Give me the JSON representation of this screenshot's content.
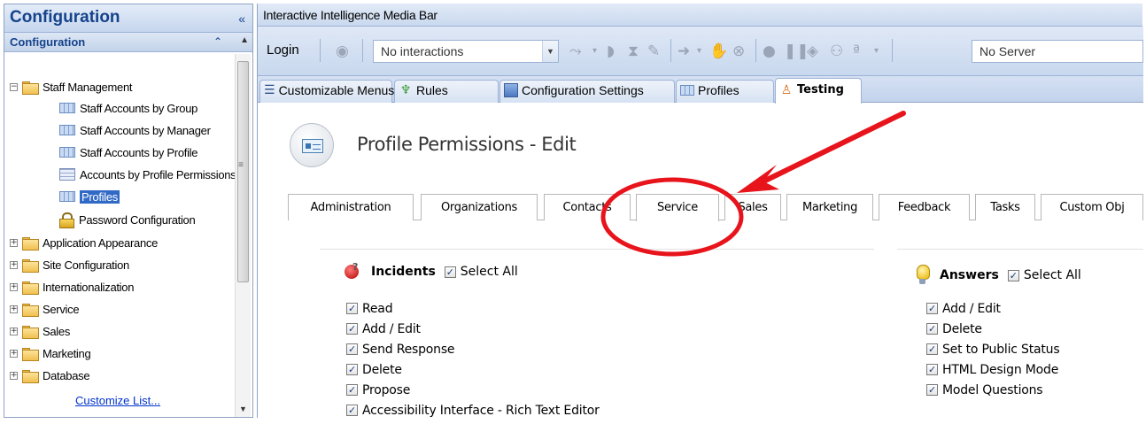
{
  "nav": {
    "title": "Configuration",
    "collapse_glyph": "«",
    "section_title": "Configuration",
    "section_glyph": "⌃",
    "tree": [
      {
        "label": "Staff Management",
        "level": 0,
        "expander": "⊟",
        "icon": "folder-icon"
      },
      {
        "label": "Staff Accounts by Group",
        "level": 1,
        "icon": "report-icon"
      },
      {
        "label": "Staff Accounts by Manager",
        "level": 1,
        "icon": "report-icon"
      },
      {
        "label": "Staff Accounts by Profile",
        "level": 1,
        "icon": "report-icon"
      },
      {
        "label": "Accounts by Profile Permissions",
        "level": 1,
        "icon": "grid-icon"
      },
      {
        "label": "Profiles",
        "level": 1,
        "icon": "report-icon",
        "selected": true
      },
      {
        "label": "Password Configuration",
        "level": 1,
        "icon": "lock-icon"
      },
      {
        "label": "Application Appearance",
        "level": 0,
        "expander": "⊞",
        "icon": "folder-icon"
      },
      {
        "label": "Site Configuration",
        "level": 0,
        "expander": "⊞",
        "icon": "folder-icon"
      },
      {
        "label": "Internationalization",
        "level": 0,
        "expander": "⊞",
        "icon": "folder-icon"
      },
      {
        "label": "Service",
        "level": 0,
        "expander": "⊞",
        "icon": "folder-icon"
      },
      {
        "label": "Sales",
        "level": 0,
        "expander": "⊞",
        "icon": "folder-icon"
      },
      {
        "label": "Marketing",
        "level": 0,
        "expander": "⊞",
        "icon": "folder-icon"
      },
      {
        "label": "Database",
        "level": 0,
        "expander": "⊞",
        "icon": "folder-icon"
      }
    ],
    "customize_link": "Customize List..."
  },
  "media_bar": {
    "title": "Interactive Intelligence Media Bar",
    "login_label": "Login",
    "interactions_value": "No interactions",
    "server_value": "No Server"
  },
  "doc_tabs": [
    {
      "label": "Customizable Menus",
      "icon": "menu-icon"
    },
    {
      "label": "Rules",
      "icon": "rules-icon"
    },
    {
      "label": "Configuration Settings",
      "icon": "config-icon"
    },
    {
      "label": "Profiles",
      "icon": "profiles-icon"
    },
    {
      "label": "Testing",
      "icon": "testing-icon",
      "active": true
    }
  ],
  "page": {
    "title": "Profile Permissions - Edit"
  },
  "permission_tabs": [
    {
      "label": "Administration"
    },
    {
      "label": "Organizations"
    },
    {
      "label": "Contacts"
    },
    {
      "label": "Service",
      "active": true
    },
    {
      "label": "Sales"
    },
    {
      "label": "Marketing"
    },
    {
      "label": "Feedback"
    },
    {
      "label": "Tasks"
    },
    {
      "label": "Custom Obj"
    }
  ],
  "incidents": {
    "label": "Incidents",
    "select_all": "Select All",
    "permissions": [
      "Read",
      "Add / Edit",
      "Send Response",
      "Delete",
      "Propose",
      "Accessibility Interface - Rich Text Editor"
    ]
  },
  "answers": {
    "label": "Answers",
    "select_all": "Select All",
    "permissions": [
      "Add / Edit",
      "Delete",
      "Set to Public Status",
      "HTML Design Mode",
      "Model Questions"
    ]
  },
  "check_glyph": "✓",
  "colors": {
    "annotation_red": "#e8141c",
    "selection_blue": "#3169c6",
    "brand_navy": "#15428b"
  }
}
